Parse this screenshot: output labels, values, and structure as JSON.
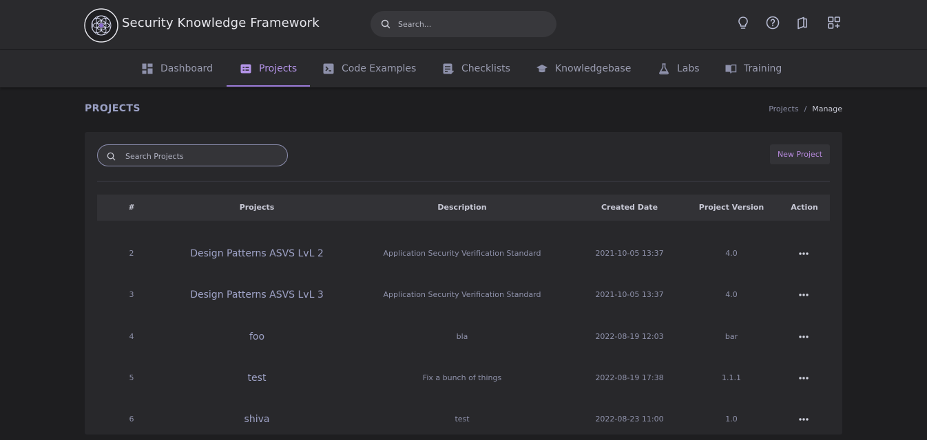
{
  "header": {
    "brand": "Security Knowledge Framework",
    "search_placeholder": "Search...",
    "icons": [
      "lightbulb-icon",
      "help-circle-icon",
      "book-icon",
      "apps-icon"
    ]
  },
  "nav": {
    "items": [
      {
        "label": "Dashboard",
        "icon": "dashboard-icon",
        "active": false
      },
      {
        "label": "Projects",
        "icon": "projects-icon",
        "active": true
      },
      {
        "label": "Code Examples",
        "icon": "code-icon",
        "active": false
      },
      {
        "label": "Checklists",
        "icon": "checklist-icon",
        "active": false
      },
      {
        "label": "Knowledgebase",
        "icon": "graduation-cap-icon",
        "active": false
      },
      {
        "label": "Labs",
        "icon": "flask-icon",
        "active": false
      },
      {
        "label": "Training",
        "icon": "book-open-icon",
        "active": false
      }
    ]
  },
  "page": {
    "title": "PROJECTS",
    "breadcrumb": {
      "link": "Projects",
      "separator": "/",
      "current": "Manage"
    }
  },
  "projects": {
    "search_placeholder": "Search Projects",
    "new_button": "New Project",
    "columns": [
      "#",
      "Projects",
      "Description",
      "Created Date",
      "Project Version",
      "Action"
    ],
    "rows": [
      {
        "num": "2",
        "name": "Design Patterns ASVS LvL 2",
        "description": "Application Security Verification Standard",
        "created": "2021-10-05 13:37",
        "version": "4.0"
      },
      {
        "num": "3",
        "name": "Design Patterns ASVS LvL 3",
        "description": "Application Security Verification Standard",
        "created": "2021-10-05 13:37",
        "version": "4.0"
      },
      {
        "num": "4",
        "name": "foo",
        "description": "bla",
        "created": "2022-08-19 12:03",
        "version": "bar"
      },
      {
        "num": "5",
        "name": "test",
        "description": "Fix a bunch of things",
        "created": "2022-08-19 17:38",
        "version": "1.1.1"
      },
      {
        "num": "6",
        "name": "shiva",
        "description": "test",
        "created": "2022-08-23 11:00",
        "version": "1.0"
      }
    ]
  },
  "colors": {
    "accent": "#b494e8",
    "background": "#1e1e20",
    "surface": "#28282b"
  }
}
